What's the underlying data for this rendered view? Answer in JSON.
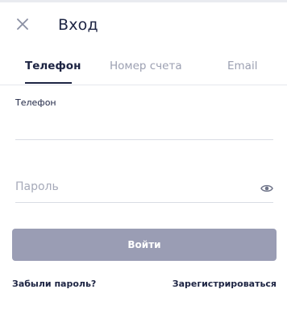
{
  "header": {
    "title": "Вход"
  },
  "tabs": [
    {
      "label": "Телефон",
      "active": true
    },
    {
      "label": "Номер счета",
      "active": false
    },
    {
      "label": "Email",
      "active": false
    }
  ],
  "form": {
    "phone_label": "Телефон",
    "phone_value": "",
    "password_placeholder": "Пароль",
    "password_value": "",
    "submit_label": "Войти"
  },
  "links": {
    "forgot": "Забыли пароль?",
    "register": "Зарегистрироваться"
  },
  "icons": {
    "close": "close-icon",
    "show_password": "eye-icon"
  },
  "colors": {
    "text": "#1d2443",
    "muted": "#9b9fb1",
    "button": "#9a9db4",
    "divider": "#d9dce4"
  }
}
